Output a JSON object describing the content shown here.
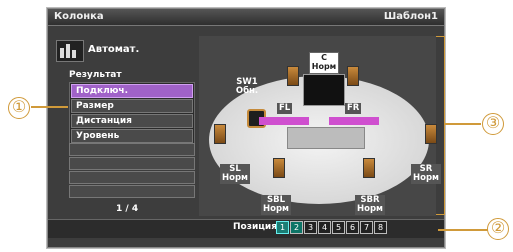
{
  "header": {
    "title": "Колонка",
    "preset": "Шаблон1"
  },
  "left_panel": {
    "auto_label": "Автомат.",
    "result_label": "Результат",
    "menu_items": [
      "Подключ.",
      "Размер",
      "Дистанция",
      "Уровень"
    ],
    "page_indicator": "1 / 4"
  },
  "speakers": {
    "center": {
      "code": "C",
      "status": "Норм"
    },
    "sub": {
      "code": "SW1",
      "status": "Обн."
    },
    "fl": {
      "code": "FL"
    },
    "fr": {
      "code": "FR"
    },
    "sl": {
      "code": "SL",
      "status": "Норм"
    },
    "sr": {
      "code": "SR",
      "status": "Норм"
    },
    "sbl": {
      "code": "SBL",
      "status": "Норм"
    },
    "sbr": {
      "code": "SBR",
      "status": "Норм"
    }
  },
  "position": {
    "label": "Позиция",
    "buttons": [
      "1",
      "2",
      "3",
      "4",
      "5",
      "6",
      "7",
      "8"
    ],
    "active": "1",
    "highlighted": "2"
  },
  "callouts": [
    "①",
    "②",
    "③"
  ],
  "colors": {
    "accent": "#a062c8",
    "callout": "#d09a3a",
    "position_active": "#1a7d74"
  }
}
